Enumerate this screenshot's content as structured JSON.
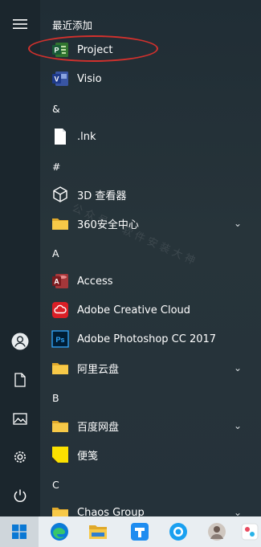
{
  "start_menu": {
    "recent_header": "最近添加",
    "recent": [
      {
        "label": "Project",
        "icon": "project-icon"
      },
      {
        "label": "Visio",
        "icon": "visio-icon"
      }
    ],
    "groups": [
      {
        "letter": "&",
        "items": [
          {
            "label": ".lnk",
            "icon": "file-icon"
          }
        ]
      },
      {
        "letter": "#",
        "items": [
          {
            "label": "3D 查看器",
            "icon": "cube-3d-icon"
          },
          {
            "label": "360安全中心",
            "icon": "folder-icon",
            "expandable": true
          }
        ]
      },
      {
        "letter": "A",
        "items": [
          {
            "label": "Access",
            "icon": "access-icon"
          },
          {
            "label": "Adobe Creative Cloud",
            "icon": "creative-cloud-icon"
          },
          {
            "label": "Adobe Photoshop CC 2017",
            "icon": "photoshop-icon"
          },
          {
            "label": "阿里云盘",
            "icon": "folder-icon",
            "expandable": true
          }
        ]
      },
      {
        "letter": "B",
        "items": [
          {
            "label": "百度网盘",
            "icon": "folder-icon",
            "expandable": true
          },
          {
            "label": "便笺",
            "icon": "sticky-notes-icon"
          }
        ]
      },
      {
        "letter": "C",
        "items": [
          {
            "label": "Chaos Group",
            "icon": "folder-icon",
            "expandable": true
          }
        ]
      }
    ],
    "watermark": "公众号：软件安装大神"
  },
  "rail": {
    "icons": [
      "menu-icon",
      "user-icon",
      "documents-icon",
      "pictures-icon",
      "settings-icon",
      "power-icon"
    ]
  },
  "taskbar": {
    "icons": [
      "windows-start-icon",
      "edge-icon",
      "file-explorer-icon",
      "tencent-docs-icon",
      "qq-browser-icon",
      "user-avatar-icon",
      "app-icon"
    ]
  },
  "colors": {
    "annotation": "#d2312d",
    "menu_bg": "#202d35",
    "taskbar_bg": "#e9eef2"
  }
}
